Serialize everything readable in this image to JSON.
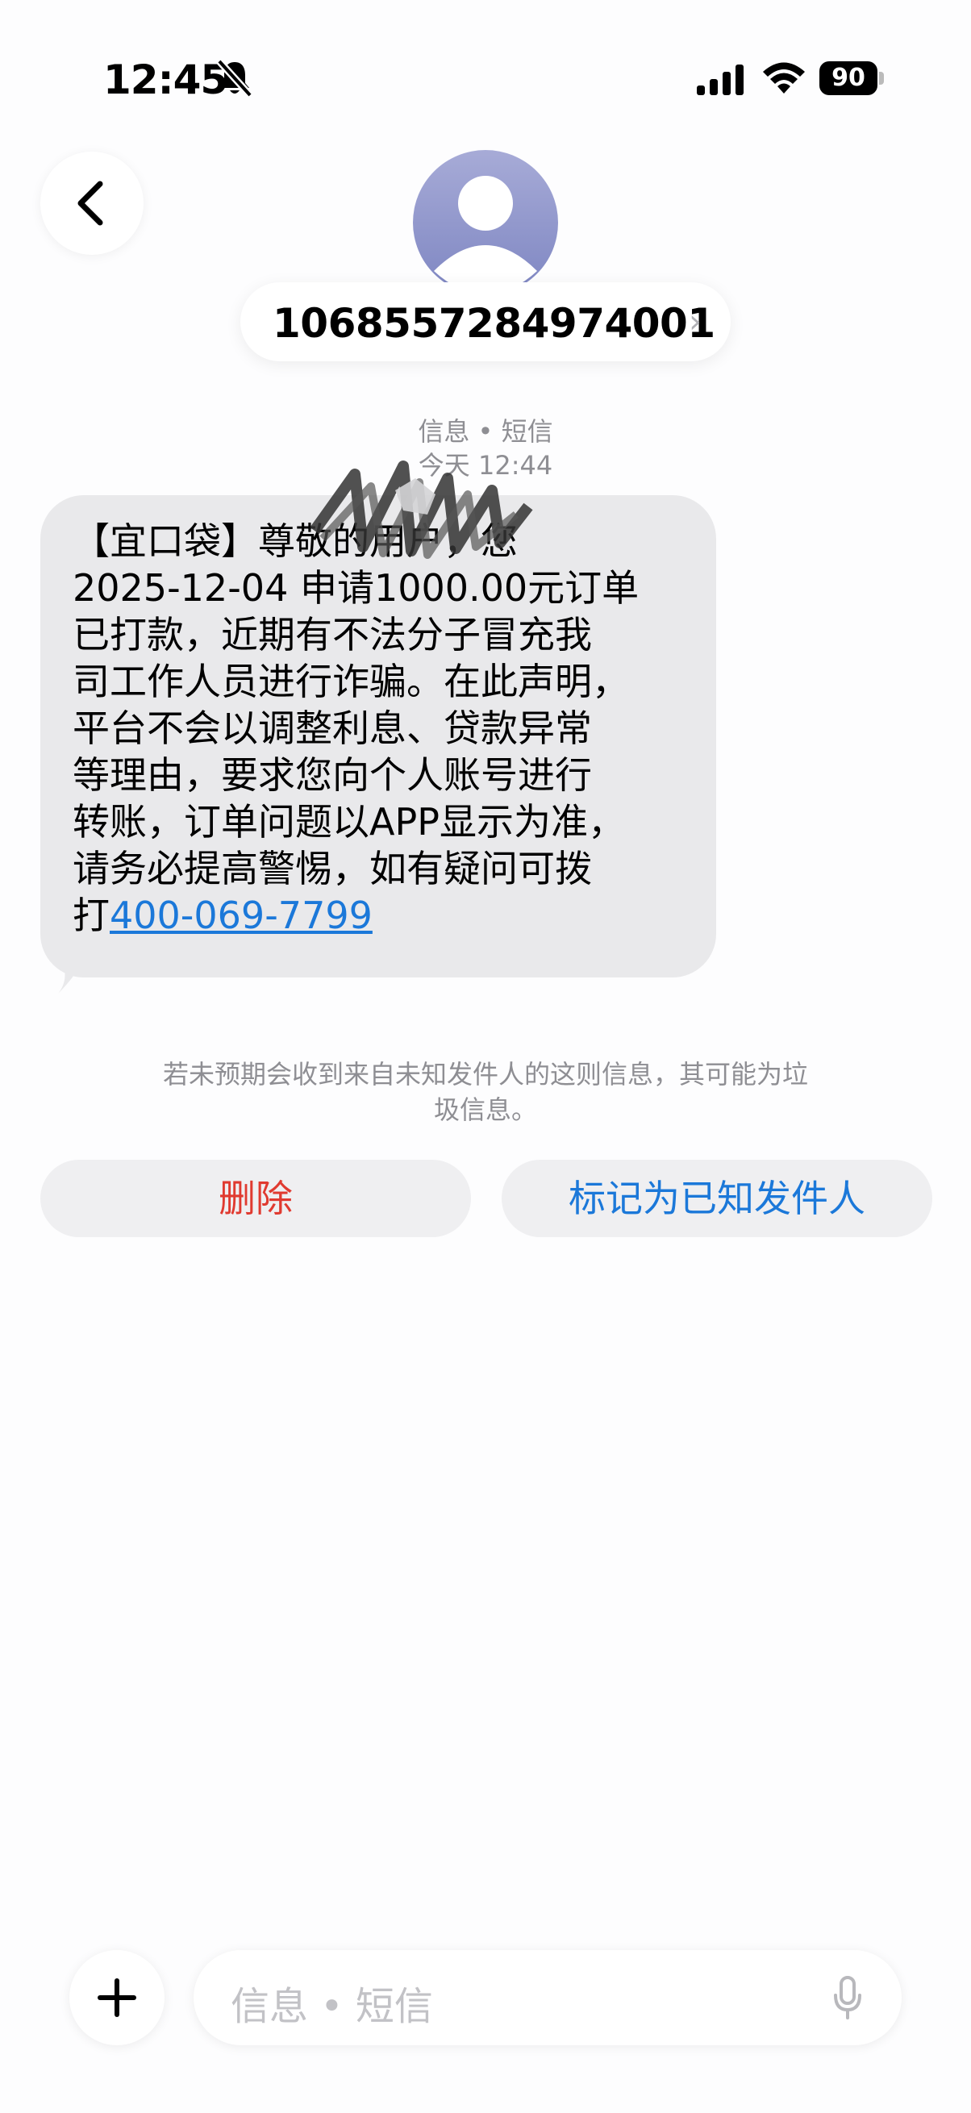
{
  "status_bar": {
    "time": "12:45",
    "battery": "90"
  },
  "header": {
    "sender_number": "1068557284974001",
    "chevron": "›"
  },
  "meta": {
    "service": "信息 • 短信",
    "timestamp": "今天 12:44"
  },
  "message": {
    "lines": [
      "【宜口袋】尊敬的用户，您",
      " 2025-12-04 申请1000.00元订单",
      "已打款，近期有不法分子冒充我",
      "司工作人员进行诈骗。在此声明，",
      "平台不会以调整利息、贷款异常",
      "等理由，要求您向个人账号进行",
      "转账，订单问题以APP显示为准，",
      "请务必提高警惕，如有疑问可拨"
    ],
    "last_prefix": "打",
    "phone_link": "400-069-7799"
  },
  "warning": "若未预期会收到来自未知发件人的这则信息，其可能为垃圾信息。",
  "actions": {
    "delete_label": "删除",
    "known_label": "标记为已知发件人"
  },
  "input": {
    "placeholder": "信息 • 短信"
  },
  "colors": {
    "link": "#1b78d9",
    "danger": "#e03a30",
    "bubble": "#e9e9eb"
  },
  "icons": [
    "bell-slash-icon",
    "cellular-signal-icon",
    "wifi-icon",
    "battery-icon",
    "chevron-left-icon",
    "person-icon",
    "plus-icon",
    "microphone-icon"
  ]
}
